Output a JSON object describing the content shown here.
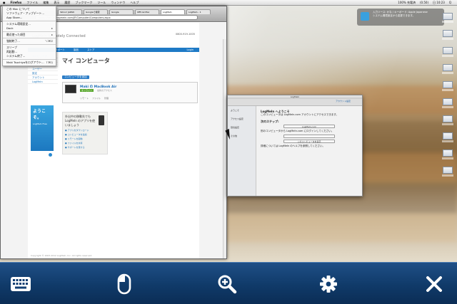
{
  "menubar": {
    "apple": "",
    "menus": [
      "Firefox",
      "ファイル",
      "編集",
      "表示",
      "履歴",
      "ブックマーク",
      "ツール",
      "ウィンドウ",
      "ヘルプ"
    ],
    "status": [
      "100% 充電済",
      "(0.50)",
      "日 10:23",
      "Q"
    ]
  },
  "dropdown": {
    "items": [
      {
        "label": "この Mac について",
        "key": ""
      },
      {
        "label": "ソフトウェア・アップデート...",
        "key": ""
      },
      {
        "label": "App Store...",
        "key": ""
      },
      {
        "sep": true
      },
      {
        "label": "システム環境設定...",
        "key": ""
      },
      {
        "label": "Dock",
        "key": "▸"
      },
      {
        "sep": true
      },
      {
        "label": "最近使った項目",
        "key": "▸"
      },
      {
        "sep": true
      },
      {
        "label": "強制終了...",
        "key": "⌥⌘⎋"
      },
      {
        "sep": true
      },
      {
        "label": "スリープ",
        "key": ""
      },
      {
        "label": "再起動...",
        "key": ""
      },
      {
        "label": "システム終了...",
        "key": ""
      },
      {
        "sep": true
      },
      {
        "label": "Maki Tsuchiyaをログアウト...",
        "key": "⇧⌘Q"
      }
    ]
  },
  "browser": {
    "tabs": [
      "Yahoo! JAPAN",
      "Googleで検索",
      "Google",
      "Official Mac",
      "LogMeIn",
      "LogMeIn - 1"
    ],
    "url": "https://secure.logmein.com/JP/Computer/Computers.aspx",
    "header_logo": "LogMeIn Remotely Connected",
    "header_right": "0800-919-1005",
    "nav": [
      "サポート",
      "製品",
      "ストア"
    ],
    "nav_user": "Login",
    "sidebar": [
      "コンピュータ",
      "ファイル",
      "レポート",
      "ユーザー",
      "設定",
      "アカウント",
      "LogMeIn"
    ],
    "welcome_title": "ようこそ。",
    "welcome_sub": "LogMeIn Free",
    "page_title": "マイ コンピュータ",
    "tagline": "コンピュータを追加",
    "computer_name": "Maki の MacBook Air",
    "computer_status": "オンライン",
    "computer_meta": "最新のアクセス",
    "computer_actions": [
      "リモート",
      "ファイル",
      "管理"
    ],
    "promo_title": "外出中の移動先でも LogMeIn のアプリを使いましょう",
    "promo_links": [
      "アプリをダウンロード",
      "コンピュータを追加",
      "リモートを起動",
      "ファイルを共有",
      "サポートを受ける"
    ],
    "footer": "Copyright © 2003-2012 LogMeIn, Inc. All rights reserved."
  },
  "dialog": {
    "title": "LogMeIn",
    "toolbar_label": "アカウント設定",
    "left_items": [
      "ようこそ",
      "アクセス設定",
      "環境設定",
      "その他"
    ],
    "heading": "LogMeIn へようこそ",
    "intro": "このコンピュータは LogMeIn.com アカウントにアクセスできます。",
    "step_heading": "次のステップ:",
    "step_text": "別のコンピュータから LogMeIn.com にログインしてください。",
    "field1": "LogMeIn.com",
    "field2": "",
    "field3": "このコンピュータを表示",
    "note": "詳細については LogMeIn のヘルプを参照してください。"
  },
  "notification": {
    "text": "入力ソース: かな / キーボード: Apple Japanese",
    "sub": "システム環境設定から変更できます。"
  },
  "toolbar": {
    "keyboard": "keyboard-icon",
    "mouse": "mouse-icon",
    "zoom": "zoom-in-icon",
    "settings": "gear-icon",
    "close": "close-icon"
  }
}
